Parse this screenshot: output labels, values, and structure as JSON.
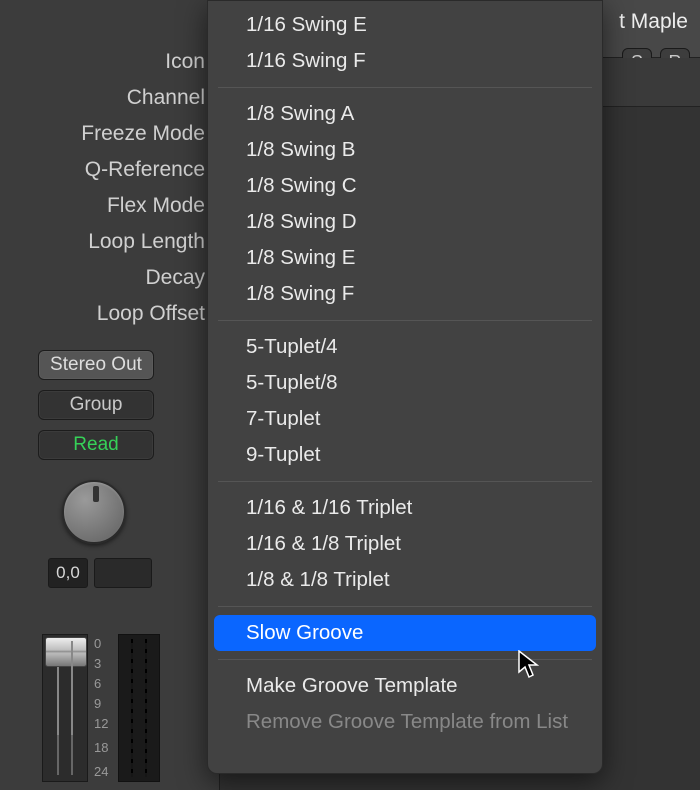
{
  "inspector": {
    "labels": [
      "Icon",
      "Channel",
      "Freeze Mode",
      "Q-Reference",
      "Flex Mode",
      "Loop Length",
      "Decay",
      "Loop Offset"
    ],
    "buttons": {
      "stereo": "Stereo Out",
      "group": "Group",
      "read": "Read"
    },
    "pan_value": "0,0",
    "scale_ticks": [
      "0",
      "3",
      "6",
      "9",
      "12",
      "18",
      "24"
    ]
  },
  "header": {
    "title_fragment": "t Maple",
    "solo": "S",
    "record": "R"
  },
  "menu": {
    "group1": [
      "1/16 Swing E",
      "1/16 Swing F"
    ],
    "group2": [
      "1/8 Swing A",
      "1/8 Swing B",
      "1/8 Swing C",
      "1/8 Swing D",
      "1/8 Swing E",
      "1/8 Swing F"
    ],
    "group3": [
      "5-Tuplet/4",
      "5-Tuplet/8",
      "7-Tuplet",
      "9-Tuplet"
    ],
    "group4": [
      "1/16 & 1/16 Triplet",
      "1/16 & 1/8 Triplet",
      "1/8 & 1/8 Triplet"
    ],
    "selected": "Slow Groove",
    "group5": [
      "Make Groove Template",
      "Remove Groove Template from List"
    ]
  }
}
